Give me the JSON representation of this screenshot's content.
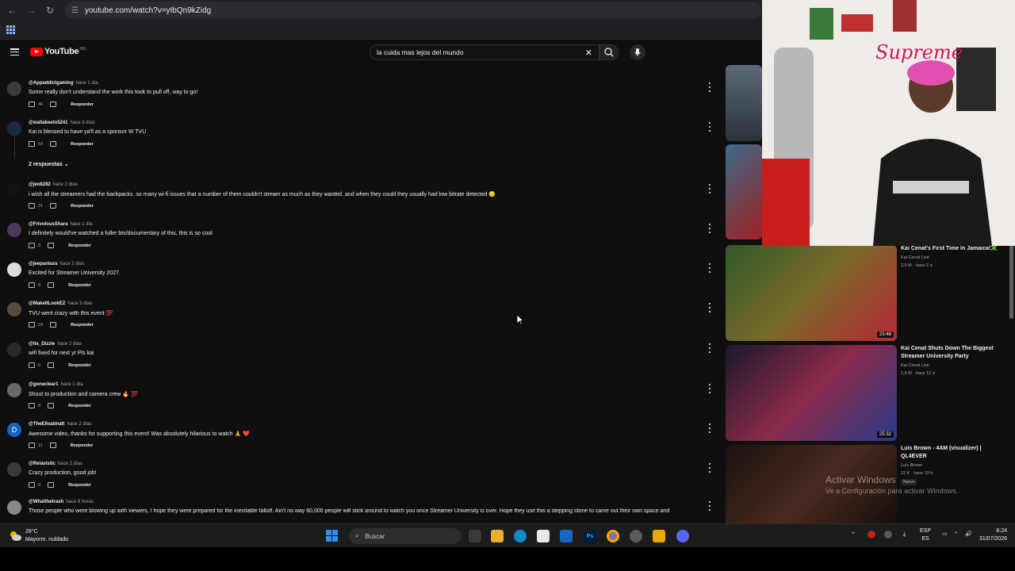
{
  "browser": {
    "url": "youtube.com/watch?v=yIbQn9kZidg"
  },
  "youtube": {
    "logo_text": "YouTube",
    "logo_region": "DO",
    "search_query": "la cuida mas lejos del mundo"
  },
  "comments": [
    {
      "author": "@Appaddictgaming",
      "time": "hace 1 día",
      "text": "Some really don't understand the work this took to pull off, way to go!",
      "likes": "46",
      "reply": "Responder",
      "avatar_color": "#3c3c3c",
      "avatar_letter": ""
    },
    {
      "author": "@wallabeetx5241",
      "time": "hace 3 días",
      "text": "Kai is blessed to have ya'll as a sponsor W TVU",
      "likes": "54",
      "reply": "Responder",
      "avatar_color": "#1e2a44",
      "avatar_letter": ""
    },
    {
      "author": "@jeo8282",
      "time": "hace 2 días",
      "text": "i wish all the streamers had the backpacks. so many wi-fi issues that a number of them couldn't stream as much as they wanted. and when they could they usually had low bitrate detected 😔",
      "likes": "31",
      "reply": "Responder",
      "avatar_color": "#111111",
      "avatar_letter": ""
    },
    {
      "author": "@FrivolousShara",
      "time": "hace 1 día",
      "text": "I definitely would've watched a fuller bts/documentary of this, this is so cool",
      "likes": "8",
      "reply": "Responder",
      "avatar_color": "#4a3a5a",
      "avatar_letter": ""
    },
    {
      "author": "@jeepanlass",
      "time": "hace 2 días",
      "text": "Excited for Streamer University 2027.",
      "likes": "8",
      "reply": "Responder",
      "avatar_color": "#dddddd",
      "avatar_letter": ""
    },
    {
      "author": "@MakeItLookEZ",
      "time": "hace 3 días",
      "text": "TVU went crazy with this event 💯",
      "likes": "24",
      "reply": "Responder",
      "avatar_color": "#5a4a3a",
      "avatar_letter": ""
    },
    {
      "author": "@its_Dizzle",
      "time": "hace 2 días",
      "text": "wifi fixed for next yr Pls kai",
      "likes": "6",
      "reply": "Responder",
      "avatar_color": "#2a2a2a",
      "avatar_letter": ""
    },
    {
      "author": "@goneclear1",
      "time": "hace 1 día",
      "text": "Shout to production and camera crew 🔥 💯",
      "likes": "8",
      "reply": "Responder",
      "avatar_color": "#6a6a6a",
      "avatar_letter": ""
    },
    {
      "author": "@TheElloatmatt",
      "time": "hace 2 días",
      "text": "Awesome video, thanks for supporting this event! Was absolutely hilarious to watch 🙏 ❤️",
      "likes": "11",
      "reply": "Responder",
      "avatar_color": "#1565c0",
      "avatar_letter": "D"
    },
    {
      "author": "@Relavistic",
      "time": "hace 2 días",
      "text": "Crazy production, good job!",
      "likes": "9",
      "reply": "Responder",
      "avatar_color": "#3a3a3a",
      "avatar_letter": ""
    },
    {
      "author": "@Whatthetrash",
      "time": "hace 8 horas",
      "text": "Those people who were blowing up with viewers, I hope they were prepared for the inevitable falloff. Ain't no way 60,000 people will stick around to watch you once Streamer University is over. Hope they use this a stepping stone to carve out their own space and",
      "likes": "",
      "reply": "",
      "avatar_color": "#888888",
      "avatar_letter": ""
    }
  ],
  "replies_toggle": "2 respuestas",
  "sidebar_videos": [
    {
      "title": "Kai Cenat's First Time In Jamaica!🇯🇲",
      "channel": "Kai Cenat Live",
      "meta": "2,5 M · hace 2 a",
      "duration": "23:48"
    },
    {
      "title": "Kai Cenat Shuts Down The Biggest Streamer University Party",
      "channel": "Kai Cenat Live",
      "meta": "1,6 M · hace 12 d",
      "duration": "25:32"
    },
    {
      "title": "Luis Brown - 4AM (visualizer) | QL4EVER",
      "channel": "Luis Brown",
      "meta": "22 K · hace 19 h",
      "duration": "",
      "badge": "Nuevo"
    }
  ],
  "watermark": {
    "line1": "Activar Windows",
    "line2": "Ve a Configuración para activar Windows."
  },
  "webcam": {
    "sign_text": "Supreme"
  },
  "taskbar": {
    "temp": "28°C",
    "weather": "Mayorm. nublado",
    "search_placeholder": "Buscar",
    "lang_top": "ESP",
    "lang_bottom": "ES",
    "time": "8:24",
    "date": "31/07/2026"
  }
}
